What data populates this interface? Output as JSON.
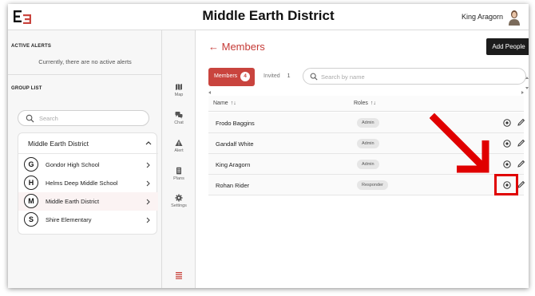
{
  "header": {
    "title": "Middle Earth District",
    "user_name": "King Aragorn"
  },
  "left_panel": {
    "alerts_label": "ACTIVE ALERTS",
    "no_alerts_text": "Currently, there are no active alerts",
    "group_list_label": "GROUP LIST",
    "search_placeholder": "Search",
    "district_name": "Middle Earth District",
    "schools": [
      {
        "initial": "G",
        "name": "Gondor High School"
      },
      {
        "initial": "H",
        "name": "Helms Deep Middle School"
      },
      {
        "initial": "M",
        "name": "Middle Earth District"
      },
      {
        "initial": "S",
        "name": "Shire Elementary"
      }
    ],
    "selected_index": 2
  },
  "nav": {
    "items": [
      {
        "label": "Map",
        "icon": "map-icon"
      },
      {
        "label": "Chat",
        "icon": "chat-icon"
      },
      {
        "label": "Alert",
        "icon": "alert-icon"
      },
      {
        "label": "Plans",
        "icon": "plans-icon"
      },
      {
        "label": "Settings",
        "icon": "settings-icon"
      }
    ],
    "menu_icon": "menu-icon"
  },
  "members": {
    "back_arrow": "←",
    "title": "Members",
    "add_button": "Add People",
    "tab_members_label": "Members",
    "tab_members_count": "4",
    "tab_invited_label": "Invited",
    "tab_invited_count": "1",
    "search_placeholder": "Search by name",
    "col_name": "Name",
    "col_roles": "Roles",
    "sort_glyph": "↑↓",
    "rows": [
      {
        "name": "Frodo Baggins",
        "role": "Admin"
      },
      {
        "name": "Gandalf White",
        "role": "Admin"
      },
      {
        "name": "King Aragorn",
        "role": "Admin"
      },
      {
        "name": "Rohan Rider",
        "role": "Responder"
      }
    ]
  },
  "colors": {
    "accent": "#c9443e",
    "annotation": "#e00000",
    "dark_button": "#1c1c1c"
  }
}
